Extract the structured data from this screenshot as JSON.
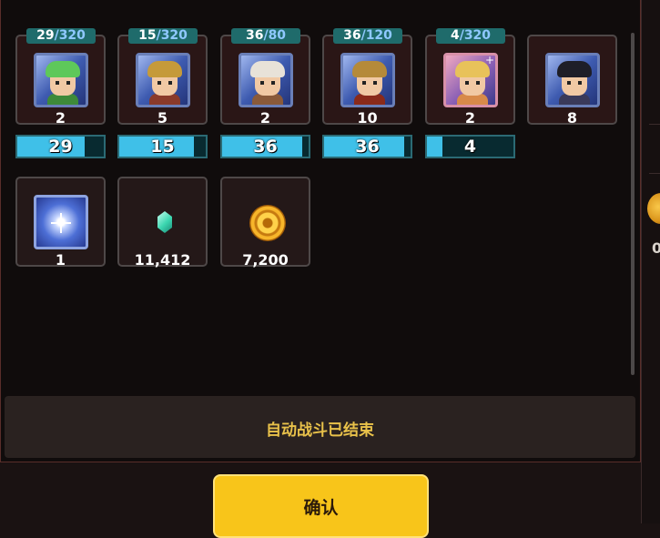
{
  "heroes": [
    {
      "id": "hero1",
      "current": "29",
      "max": "320",
      "count": "2",
      "progress": "29",
      "progress_fraction": 0.0906,
      "portrait": "green-hair-girl",
      "hair": "#5ec85a",
      "outfit": "#3e8a3a"
    },
    {
      "id": "hero2",
      "current": "15",
      "max": "320",
      "count": "5",
      "progress": "15",
      "progress_fraction": 0.0469,
      "portrait": "gold-helmet-girl",
      "hair": "#c59a3a",
      "outfit": "#8a3a2a"
    },
    {
      "id": "hero3",
      "current": "36",
      "max": "80",
      "count": "2",
      "progress": "36",
      "progress_fraction": 0.45,
      "portrait": "bald-old-warrior",
      "hair": "#e8e2d8",
      "outfit": "#8a5a3a"
    },
    {
      "id": "hero4",
      "current": "36",
      "max": "120",
      "count": "10",
      "progress": "36",
      "progress_fraction": 0.3,
      "portrait": "gold-armor-warrior",
      "hair": "#b58a3a",
      "outfit": "#8a2a1a"
    },
    {
      "id": "hero5",
      "current": "4",
      "max": "320",
      "count": "2",
      "progress": "4",
      "progress_fraction": 0.0125,
      "portrait": "blonde-hooded-girl",
      "hair": "#e8c25a",
      "outfit": "#d88a4a"
    },
    {
      "id": "hero6",
      "count": "8",
      "portrait": "dark-hair-woman",
      "hair": "#1e1e28",
      "outfit": "#3a3a5a"
    }
  ],
  "items": [
    {
      "id": "item1",
      "count": "1",
      "icon": "star-gem-icon"
    },
    {
      "id": "item2",
      "count": "11,412",
      "icon": "crystal-icon"
    },
    {
      "id": "item3",
      "count": "7,200",
      "icon": "gold-coin-icon"
    }
  ],
  "status": {
    "text": "自动战斗已结束"
  },
  "confirm": {
    "label": "确认"
  },
  "background": {
    "partial_text": "0"
  },
  "colors": {
    "tag_bg": "#1f6b6b",
    "bar_fill": "#3fc0e8",
    "button": "#f8c51a",
    "status_text": "#e9c24a"
  }
}
